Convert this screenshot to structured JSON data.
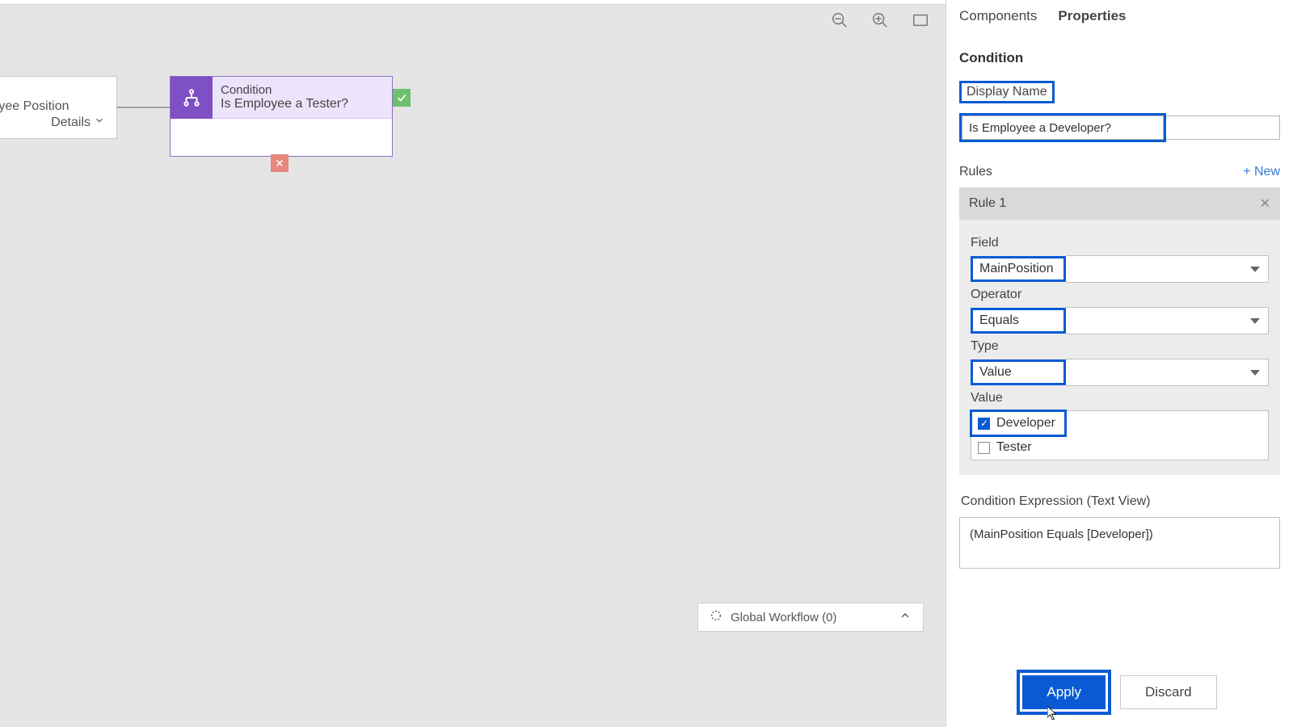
{
  "canvas": {
    "prev_node": {
      "label_line1": "ee",
      "label_line2": "Employee Position",
      "details_label": "Details"
    },
    "condition_node": {
      "type_label": "Condition",
      "name": "Is Employee a Tester?"
    },
    "global_workflow": "Global Workflow (0)"
  },
  "panel": {
    "tabs": {
      "components": "Components",
      "properties": "Properties",
      "active": "properties"
    },
    "section": "Condition",
    "display_name": {
      "label": "Display Name",
      "value": "Is Employee a Developer?"
    },
    "rules": {
      "label": "Rules",
      "new_label": "+ New",
      "rule_title": "Rule 1",
      "field": {
        "label": "Field",
        "value": "MainPosition"
      },
      "operator": {
        "label": "Operator",
        "value": "Equals"
      },
      "type": {
        "label": "Type",
        "value": "Value"
      },
      "value": {
        "label": "Value",
        "options": [
          {
            "label": "Developer",
            "checked": true
          },
          {
            "label": "Tester",
            "checked": false
          }
        ]
      }
    },
    "expression": {
      "label": "Condition Expression (Text View)",
      "value": "(MainPosition Equals [Developer])"
    },
    "buttons": {
      "apply": "Apply",
      "discard": "Discard"
    }
  }
}
